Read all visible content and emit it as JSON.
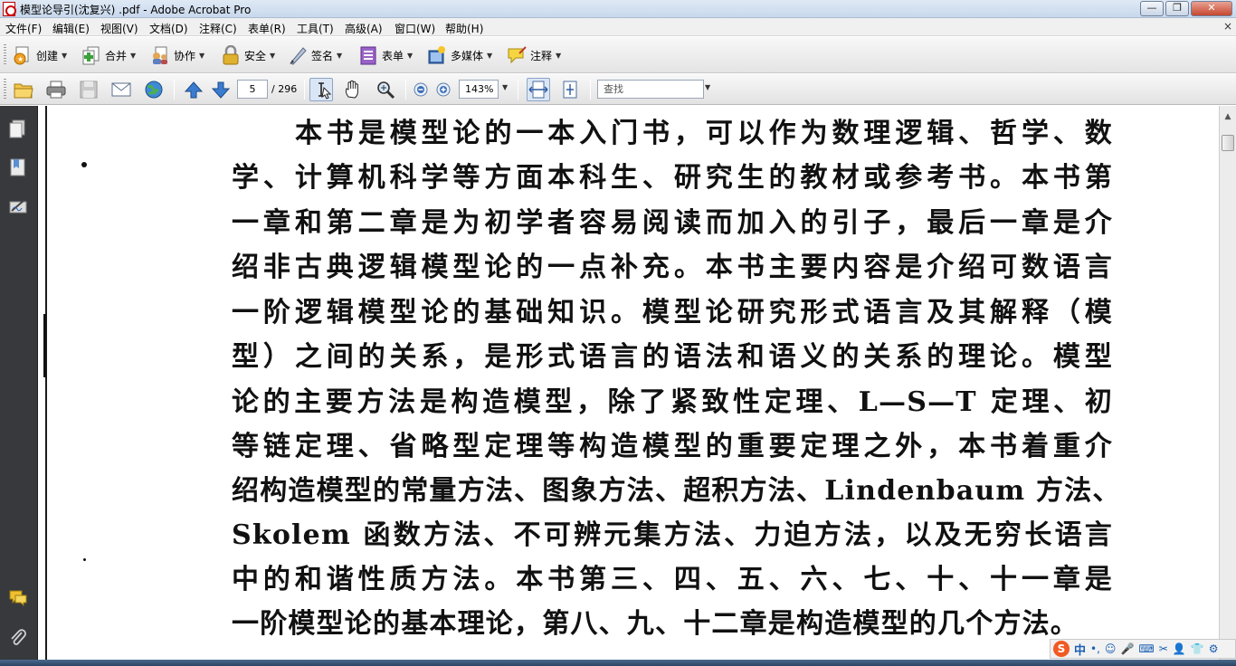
{
  "window": {
    "title": "模型论导引(沈复兴) .pdf - Adobe Acrobat Pro",
    "controls": {
      "minimize": "—",
      "maximize": "❐",
      "close": "✕"
    }
  },
  "menubar": {
    "items": [
      "文件(F)",
      "编辑(E)",
      "视图(V)",
      "文档(D)",
      "注释(C)",
      "表单(R)",
      "工具(T)",
      "高级(A)",
      "窗口(W)",
      "帮助(H)"
    ],
    "close_glyph": "×"
  },
  "toolbar_tasks": [
    {
      "label": "创建",
      "icon": "create-pdf-icon"
    },
    {
      "label": "合并",
      "icon": "combine-icon"
    },
    {
      "label": "协作",
      "icon": "collaborate-icon"
    },
    {
      "label": "安全",
      "icon": "lock-icon"
    },
    {
      "label": "签名",
      "icon": "pen-icon"
    },
    {
      "label": "表单",
      "icon": "form-icon"
    },
    {
      "label": "多媒体",
      "icon": "multimedia-icon"
    },
    {
      "label": "注释",
      "icon": "comment-icon"
    }
  ],
  "toolbar_nav": {
    "page_current": "5",
    "page_total": "/ 296",
    "zoom": "143%",
    "search_placeholder": "查找"
  },
  "document": {
    "lines": [
      "本书是模型论的一本入门书，可以作为数理逻辑、哲学、数",
      "学、计算机科学等方面本科生、研究生的教材或参考书。本书第",
      "一章和第二章是为初学者容易阅读而加入的引子，最后一章是介",
      "绍非古典逻辑模型论的一点补充。本书主要内容是介绍可数语言",
      "一阶逻辑模型论的基础知识。模型论研究形式语言及其解释（模",
      "型）之间的关系，是形式语言的语法和语义的关系的理论。模型",
      "论的主要方法是构造模型，除了紧致性定理、L—S—T 定理、初",
      "等链定理、省略型定理等构造模型的重要定理之外，本书着重介",
      "绍构造模型的常量方法、图象方法、超积方法、Lindenbaum 方法、",
      "Skolem 函数方法、不可辨元集方法、力迫方法，以及无穷长语言",
      "中的和谐性质方法。本书第三、四、五、六、七、十、十一章是",
      "一阶模型论的基本理论，第八、九、十二章是构造模型的几个方法。"
    ]
  },
  "ime": {
    "logo": "S",
    "mode": "中",
    "symbols": [
      "•,",
      "☺",
      "🎤",
      "⌨",
      "✂",
      "👤",
      "👕",
      "⚙"
    ]
  },
  "colors": {
    "nav_panel": "#37393d",
    "ime_logo": "#f15a22",
    "ime_text": "#1a5fb4"
  }
}
